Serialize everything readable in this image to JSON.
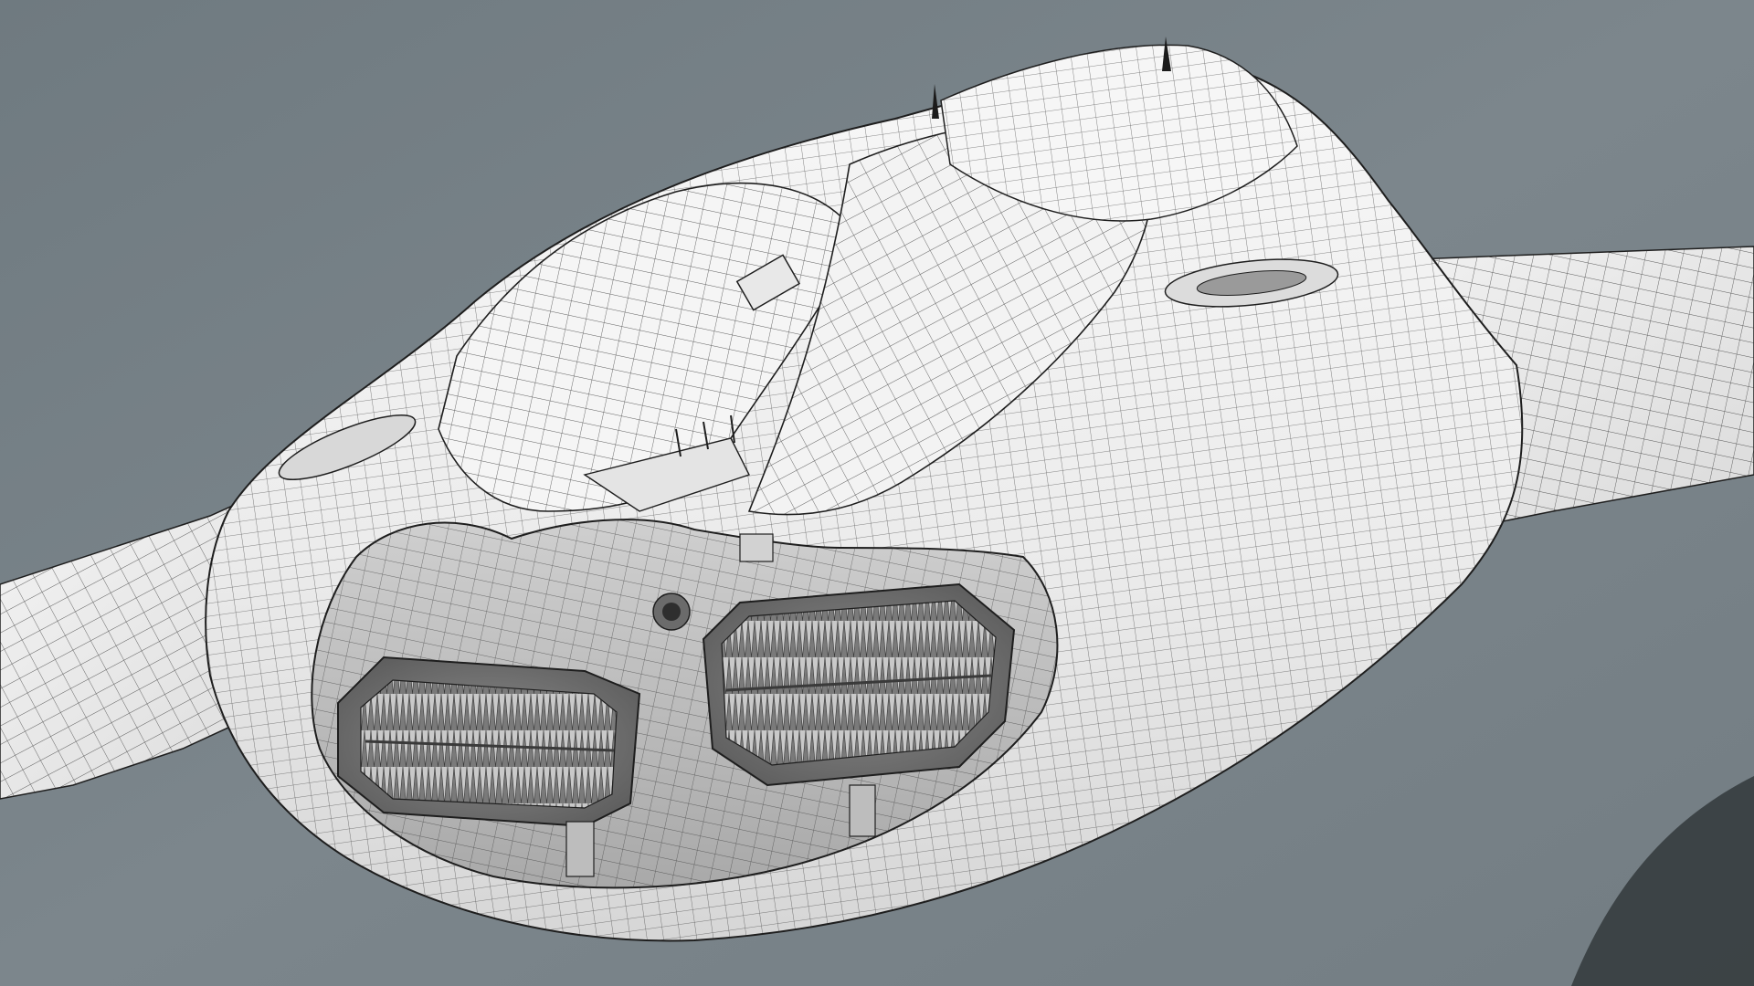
{
  "scene": {
    "subject": "wireframe-spaceship-model",
    "background_color": "#7b858b",
    "hull_color": "#f2f2f2",
    "wire_color": "#1e1e1e",
    "shadow_color": "#2c3033"
  },
  "icons": {
    "engine_left": "engine-intake-icon",
    "engine_right": "engine-intake-icon",
    "hatch": "hatch-icon"
  }
}
